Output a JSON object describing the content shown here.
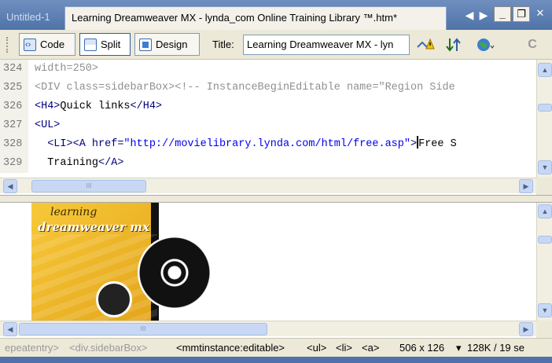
{
  "tabs": [
    {
      "label": "Untitled-1"
    },
    {
      "label": "Learning Dreamweaver MX - lynda_com Online Training Library ™.htm*"
    }
  ],
  "window_controls": {
    "prev": "◀",
    "next": "▶",
    "minimize": "_",
    "restore": "❐",
    "close": "✕"
  },
  "toolbar": {
    "code_label": "Code",
    "split_label": "Split",
    "design_label": "Design",
    "title_label": "Title:",
    "title_value": "Learning Dreamweaver MX - lyn",
    "refresh_symbol": "C"
  },
  "code": {
    "lines": [
      {
        "num": "324",
        "parts": [
          {
            "cls": "c-gray",
            "text": "width=250>"
          }
        ]
      },
      {
        "num": "325",
        "parts": [
          {
            "cls": "c-gray",
            "text": "<DIV class=sidebarBox><!-- InstanceBeginEditable name=\"Region Side"
          }
        ]
      },
      {
        "num": "326",
        "parts": [
          {
            "cls": "c-tag",
            "text": "<H4>"
          },
          {
            "cls": "c-text",
            "text": "Quick links"
          },
          {
            "cls": "c-tag",
            "text": "</H4>"
          }
        ]
      },
      {
        "num": "327",
        "parts": [
          {
            "cls": "c-tag",
            "text": "<UL>"
          }
        ]
      },
      {
        "num": "328",
        "parts": [
          {
            "cls": "c-text",
            "text": "  "
          },
          {
            "cls": "c-tag",
            "text": "<LI><A href="
          },
          {
            "cls": "c-str",
            "text": "\"http://movielibrary.lynda.com/html/free.asp\""
          },
          {
            "cls": "c-tag",
            "text": ">"
          },
          {
            "cls": "caret",
            "text": ""
          },
          {
            "cls": "c-text",
            "text": "Free S"
          }
        ]
      },
      {
        "num": "329",
        "parts": [
          {
            "cls": "c-text",
            "text": "  Training"
          },
          {
            "cls": "c-tag",
            "text": "</A>"
          }
        ]
      }
    ]
  },
  "cover": {
    "line1": "learning",
    "line2": "dreamweaver mx"
  },
  "status": {
    "crumbs_dim": [
      "epeatentry>",
      "<div.sidebarBox>"
    ],
    "crumbs": [
      "<mmtinstance:editable>",
      "<ul>",
      "<li>",
      "<a>"
    ],
    "window_size": "506 x 126",
    "size_arrow": "▾",
    "file_info": "128K / 19 se"
  },
  "colors": {
    "tab_bar": "#4f73a8",
    "chrome": "#ece9d8",
    "tag": "#000080",
    "string": "#0000ee",
    "scroll": "#c8d8f4"
  }
}
